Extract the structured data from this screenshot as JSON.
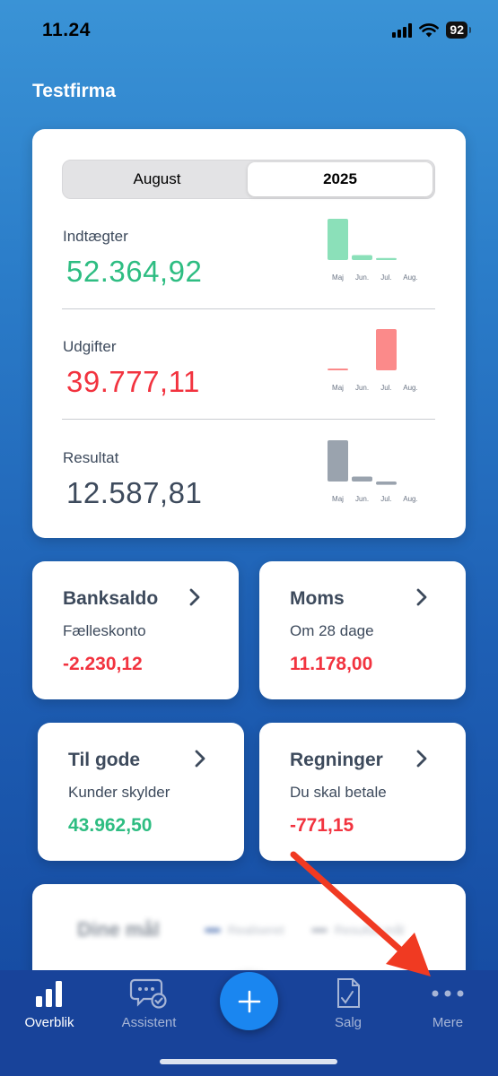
{
  "status_bar": {
    "time": "11.24",
    "battery": "92"
  },
  "company": {
    "name": "Testfirma"
  },
  "overview": {
    "period_toggle": {
      "left": "August",
      "right": "2025",
      "selected": "2025"
    },
    "metrics": [
      {
        "label": "Indtægter",
        "value": "52.364,92",
        "color": "#2ebd82",
        "mini_chart": {
          "type": "bar",
          "categories": [
            "Maj",
            "Jun.",
            "Jul.",
            "Aug."
          ],
          "values": [
            1.0,
            0.12,
            0.05,
            0
          ],
          "bar_color": "#8be0b9"
        }
      },
      {
        "label": "Udgifter",
        "value": "39.777,11",
        "color": "#f2333f",
        "mini_chart": {
          "type": "bar",
          "categories": [
            "Maj",
            "Jun.",
            "Jul.",
            "Aug."
          ],
          "values": [
            0.04,
            0,
            1.0,
            0
          ],
          "bar_color": "#fb8a8a"
        }
      },
      {
        "label": "Resultat",
        "value": "12.587,81",
        "color": "#3d4a5c",
        "mini_chart": {
          "type": "bar",
          "categories": [
            "Maj",
            "Jun.",
            "Jul.",
            "Aug."
          ],
          "values": [
            1.0,
            0.12,
            -0.08,
            0
          ],
          "bar_color": "#9aa3ae"
        }
      }
    ]
  },
  "cards": {
    "banksaldo": {
      "title": "Banksaldo",
      "subtitle": "Fælleskonto",
      "value": "-2.230,12"
    },
    "moms": {
      "title": "Moms",
      "subtitle": "Om 28 dage",
      "value": "11.178,00"
    },
    "til_gode": {
      "title": "Til gode",
      "subtitle": "Kunder skylder",
      "value": "43.962,50"
    },
    "regninger": {
      "title": "Regninger",
      "subtitle": "Du skal betale",
      "value": "-771,15"
    }
  },
  "goals": {
    "title": "Dine mål",
    "legend_realized": "Realiseret",
    "legend_target": "Resultat mål"
  },
  "tab_bar": {
    "items": [
      {
        "label": "Overblik",
        "icon": "bar-chart-icon",
        "active": true
      },
      {
        "label": "Assistent",
        "icon": "chat-assistant-icon",
        "active": false
      },
      {
        "label": "Salg",
        "icon": "document-check-icon",
        "active": false
      },
      {
        "label": "Mere",
        "icon": "more-dots-icon",
        "active": false
      }
    ],
    "fab_icon": "plus-icon"
  },
  "colors": {
    "accent": "#1a86f0",
    "positive": "#2ebd82",
    "negative": "#f2333f",
    "annotation_arrow": "#f03a22"
  }
}
